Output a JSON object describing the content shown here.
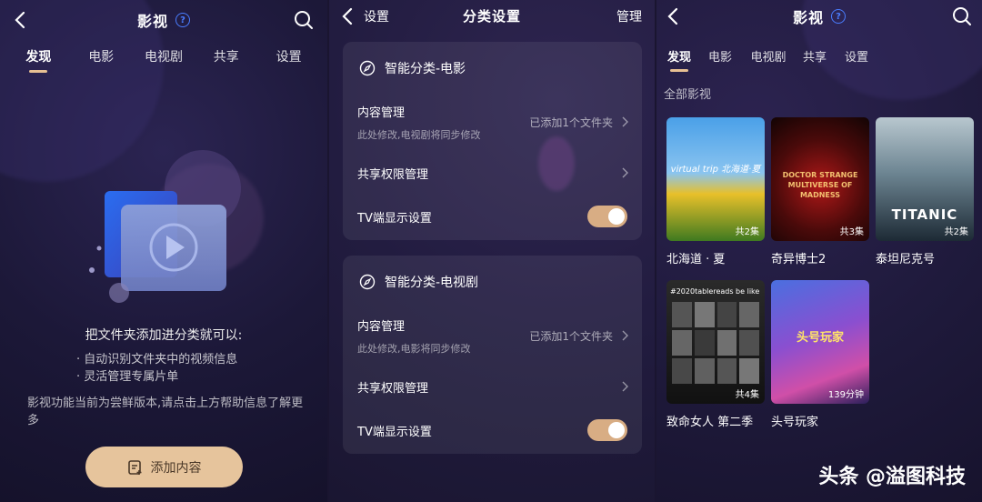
{
  "panel1": {
    "title": "影视",
    "help_icon": "?",
    "tabs": [
      "发现",
      "电影",
      "电视剧",
      "共享",
      "设置"
    ],
    "empty_title": "把文件夹添加进分类就可以:",
    "bullets": [
      "· 自动识别文件夹中的视频信息",
      "· 灵活管理专属片单"
    ],
    "note": "影视功能当前为尝鲜版本,请点击上方帮助信息了解更多",
    "add_button": "添加内容"
  },
  "panel2": {
    "back_label": "设置",
    "title": "分类设置",
    "manage_label": "管理",
    "cards": [
      {
        "header": "智能分类-电影",
        "content_label": "内容管理",
        "content_sub": "此处修改,电视剧将同步修改",
        "content_value": "已添加1个文件夹",
        "share_label": "共享权限管理",
        "tv_label": "TV端显示设置"
      },
      {
        "header": "智能分类-电视剧",
        "content_label": "内容管理",
        "content_sub": "此处修改,电影将同步修改",
        "content_value": "已添加1个文件夹",
        "share_label": "共享权限管理",
        "tv_label": "TV端显示设置"
      }
    ]
  },
  "panel3": {
    "title": "影视",
    "help_icon": "?",
    "tabs": [
      "发现",
      "电影",
      "电视剧",
      "共享",
      "设置"
    ],
    "section": "全部影视",
    "posters": [
      {
        "name": "北海道 · 夏",
        "badge": "共2集",
        "art": "virtual trip 北海道·夏"
      },
      {
        "name": "奇异博士2",
        "badge": "共3集",
        "art": "DOCTOR STRANGE MULTIVERSE OF MADNESS"
      },
      {
        "name": "泰坦尼克号",
        "badge": "共2集",
        "art": "TITANIC"
      },
      {
        "name": "致命女人 第二季",
        "badge": "共4集",
        "art": "#2020tablereads be like"
      },
      {
        "name": "头号玩家",
        "badge": "139分钟",
        "art": "头号玩家"
      }
    ]
  },
  "watermark": "头条 @溢图科技",
  "colors": {
    "accent": "#e7c093",
    "help_blue": "#4a7dff",
    "toggle_on": "#d8ad84"
  }
}
